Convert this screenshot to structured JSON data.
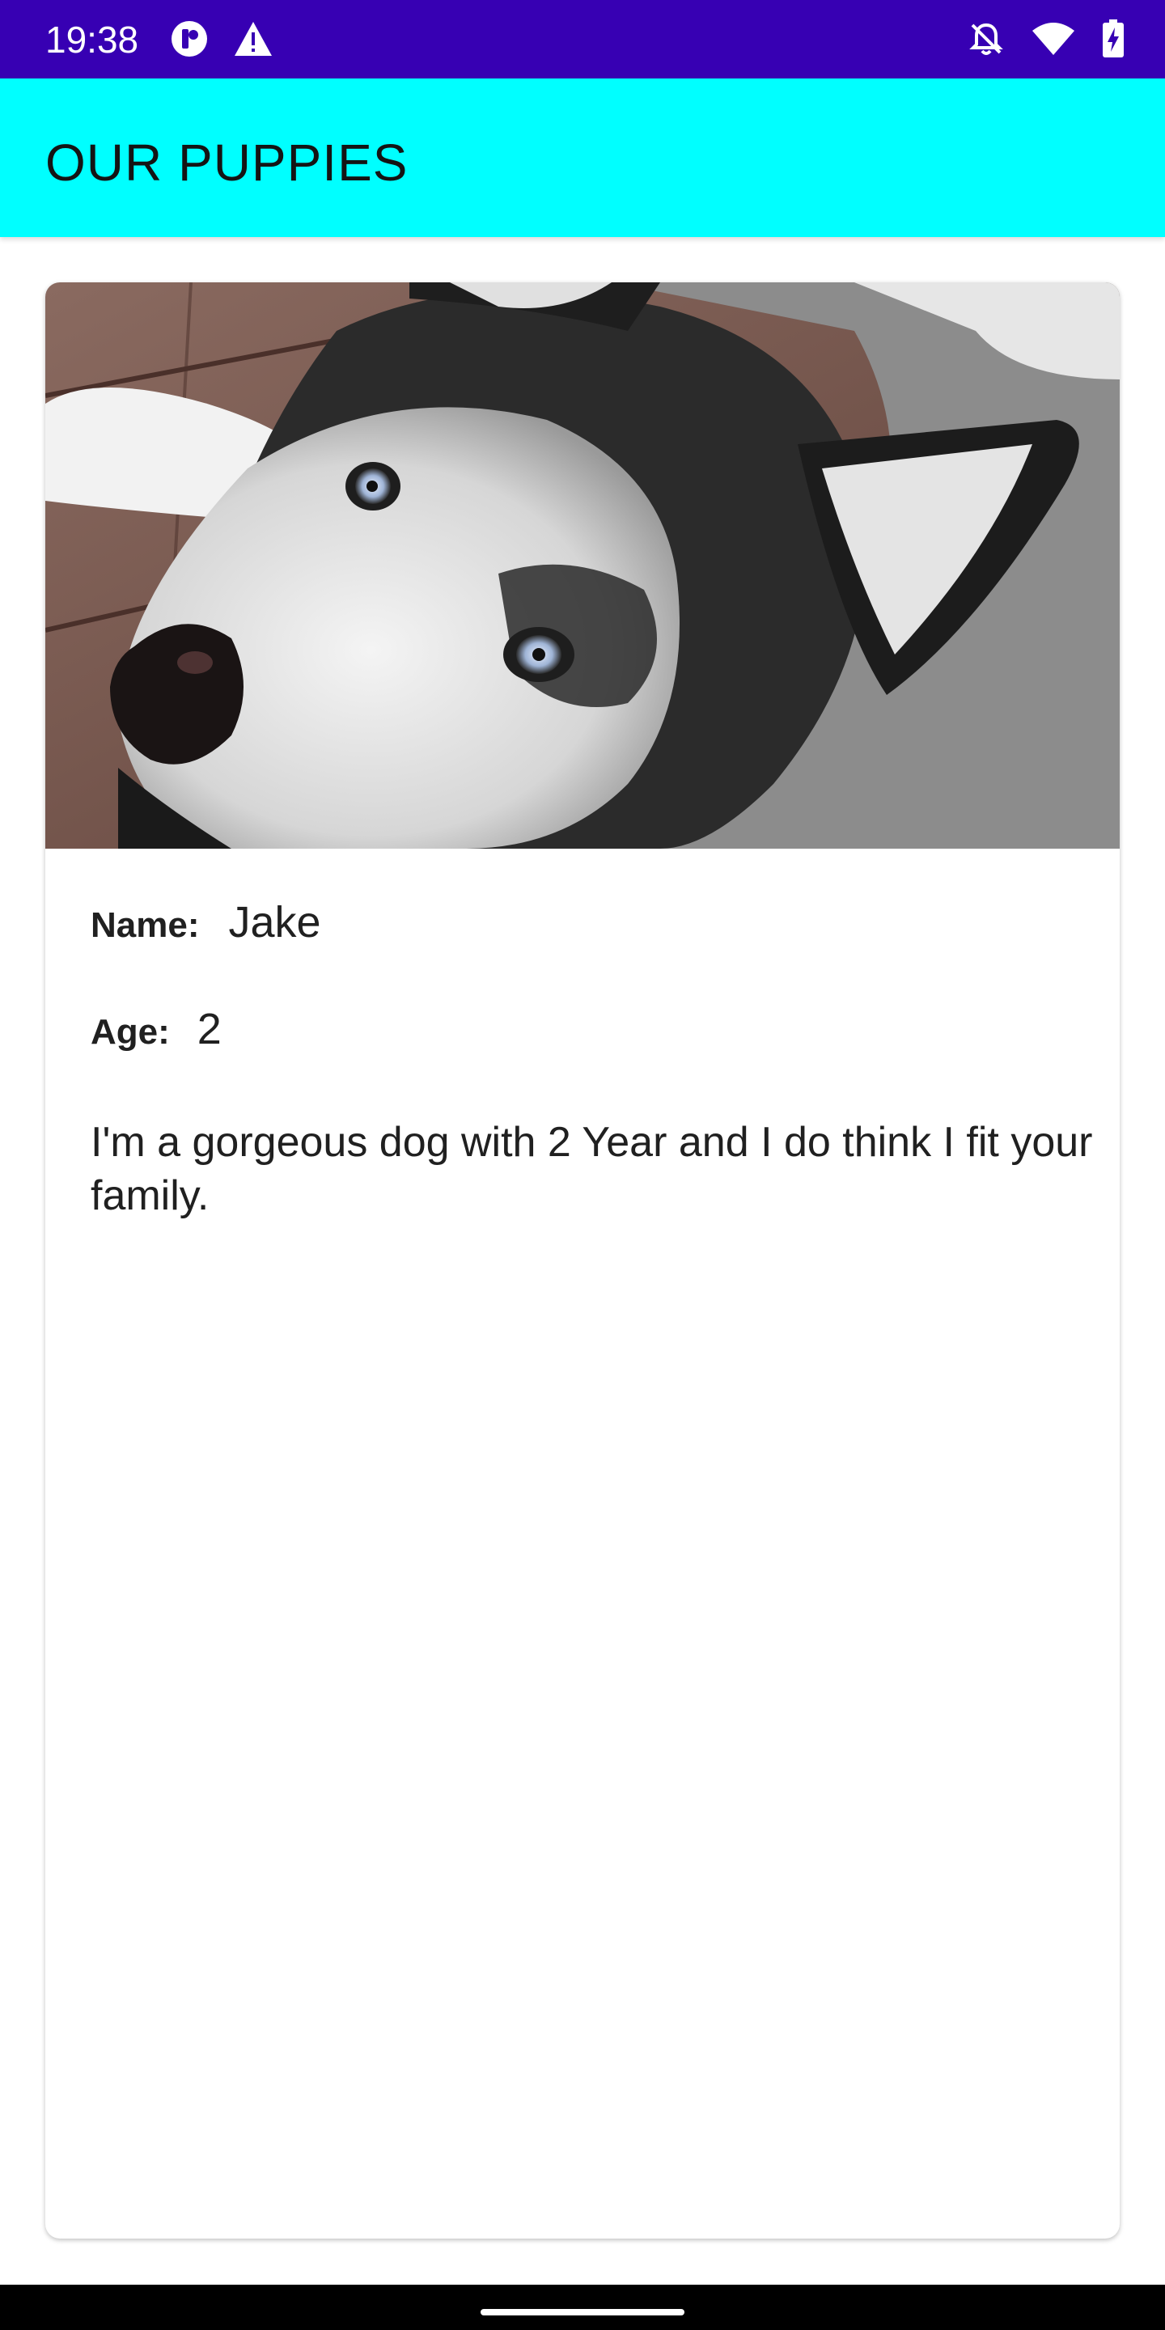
{
  "status_bar": {
    "time": "19:38",
    "left_icons": [
      "app-notification-icon",
      "warning-icon"
    ],
    "right_icons": [
      "notifications-off-icon",
      "wifi-icon",
      "battery-charging-icon"
    ],
    "background": "#3700b3"
  },
  "app_bar": {
    "title": "OUR PUPPIES",
    "background": "#00ffff"
  },
  "puppy": {
    "image": "husky-photo",
    "name_label": "Name:",
    "name": "Jake",
    "age_label": "Age:",
    "age": "2",
    "description": "I'm a gorgeous dog with 2 Year and I do think I fit your family."
  }
}
